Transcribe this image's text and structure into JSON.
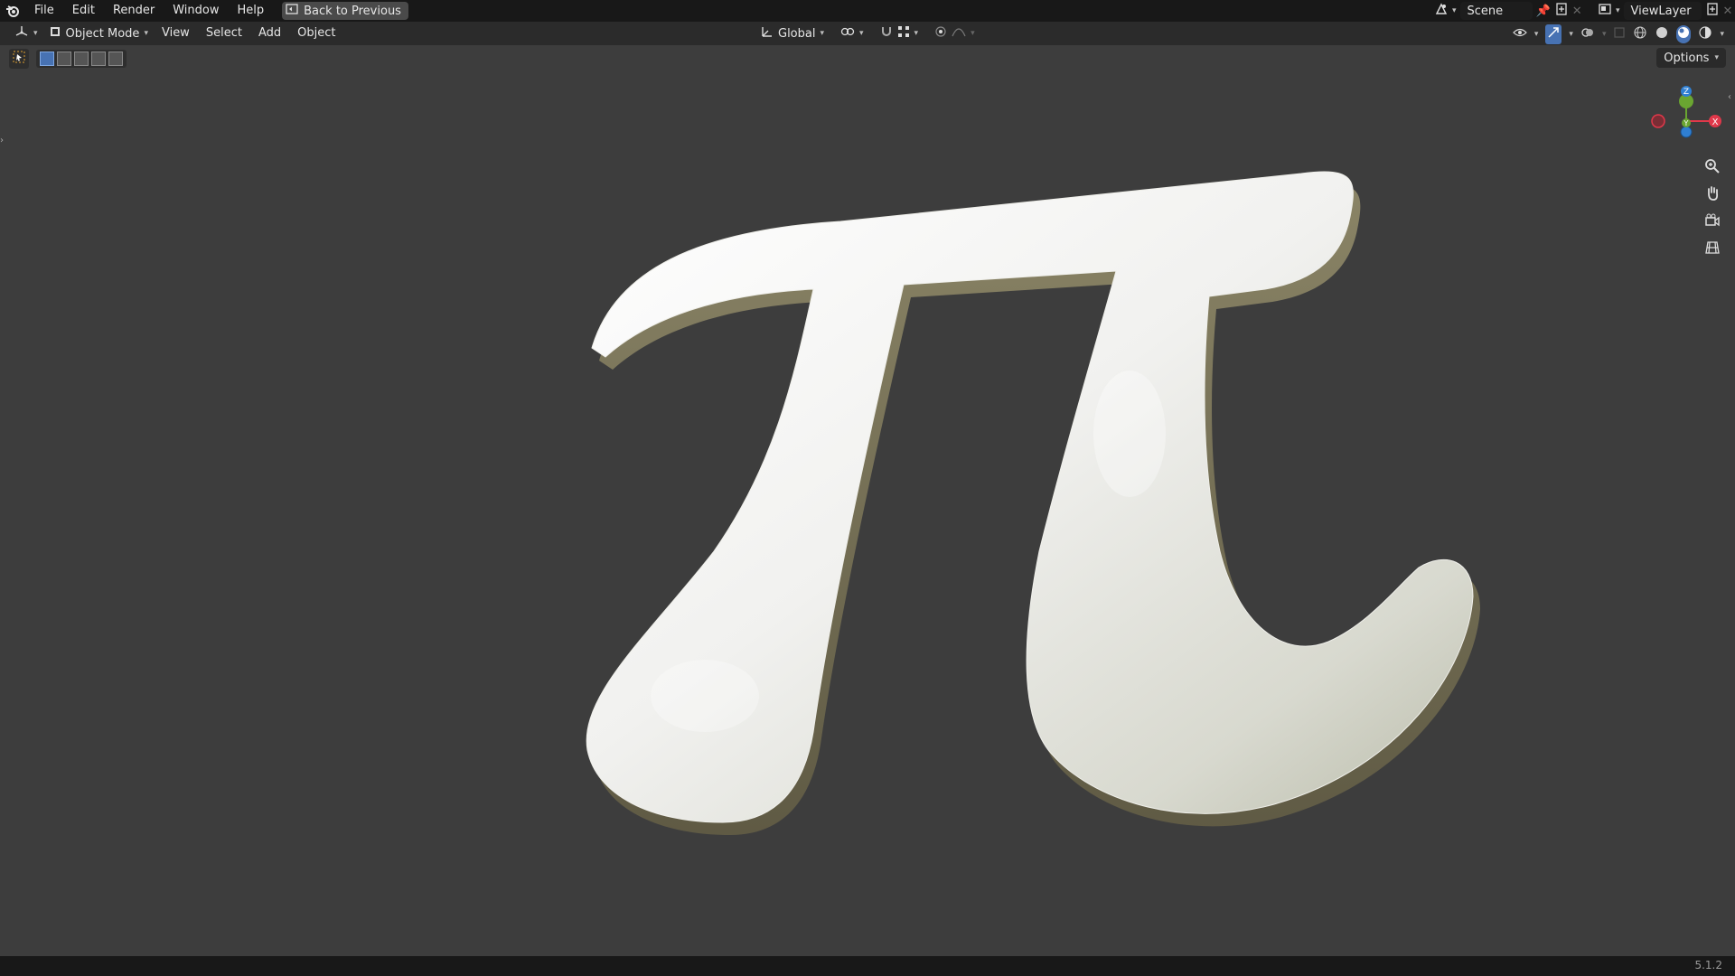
{
  "menu": {
    "items": [
      "File",
      "Edit",
      "Render",
      "Window",
      "Help"
    ],
    "back_label": "Back to Previous"
  },
  "header": {
    "mode_label": "Object Mode",
    "view_menu": [
      "View",
      "Select",
      "Add",
      "Object"
    ],
    "orientation_label": "Global"
  },
  "scene": {
    "scene_name": "Scene",
    "view_layer_name": "ViewLayer"
  },
  "viewport": {
    "options_label": "Options",
    "gizmo_axes": [
      "Z",
      "Y",
      "X"
    ],
    "object": "pi-symbol",
    "colors": {
      "background": "#3d3d3d",
      "x_axis": "#e0384a",
      "y_axis": "#6aa531",
      "z_axis": "#2f7fd2"
    }
  },
  "status": {
    "version": "5.1.2"
  }
}
